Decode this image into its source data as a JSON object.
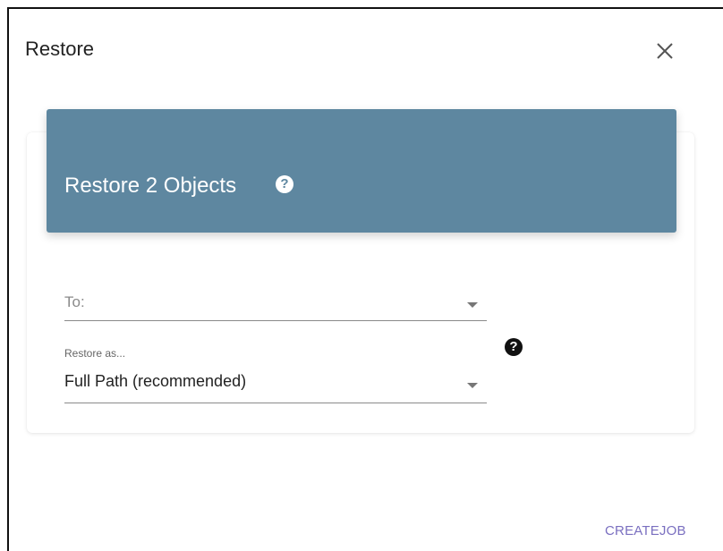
{
  "dialog": {
    "title": "Restore",
    "close_icon": "close-icon"
  },
  "card": {
    "header_title": "Restore 2 Objects",
    "header_help_icon": "help-circle-icon",
    "header_help_glyph": "?",
    "header_color": "#5e87a0"
  },
  "form": {
    "to": {
      "placeholder": "To:",
      "value": ""
    },
    "restore_as": {
      "label": "Restore as...",
      "value": "Full Path (recommended)",
      "help_icon": "help-circle-icon",
      "help_glyph": "?"
    }
  },
  "actions": {
    "create_job_label": "CREATEJOB",
    "accent_color": "#7a6fc0"
  }
}
